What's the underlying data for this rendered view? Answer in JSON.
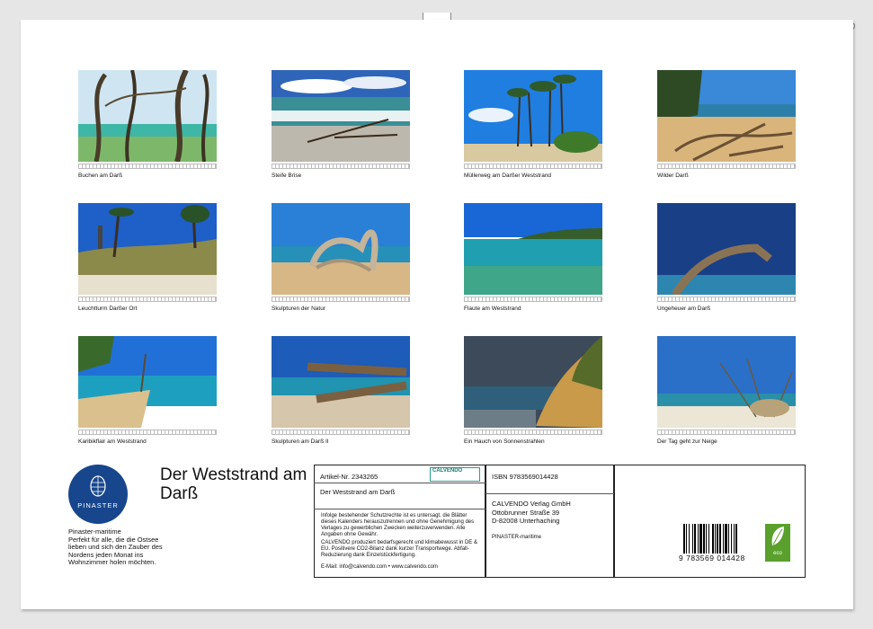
{
  "captions": [
    "Buchen am Darß",
    "Steife Brise",
    "Müllerweg am Darßer Weststrand",
    "Wilder Darß",
    "Leuchtturm Darßer Ort",
    "Skulpturen der Natur",
    "Flaute am Weststrand",
    "Ungeheuer am Darß",
    "Karibikflair am Weststrand",
    "Skulpturen am Darß II",
    "Ein Hauch von Sonnenstrahlen",
    "Der Tag geht zur Neige"
  ],
  "publisher": {
    "logo_text": "PINASTER",
    "name": "Pinaster-maritime",
    "description": "Perfekt für alle, die die Ostsee lieben und sich den Zauber des Nordens jeden Monat ins Wohnzimmer holen möchten."
  },
  "title": "Der Weststrand am Darß",
  "info": {
    "article_no": "Artikel-Nr. 2343265",
    "calvendo_logo": "CALVENDO",
    "title": "Der Weststrand am Darß",
    "copyright_text": "Infolge bestehender Schutzrechte ist es untersagt, die Blätter dieses Kalenders herauszutrennen und ohne Genehmigung des Verlages zu gewerblichen Zwecken weiterzuverwenden. Alle Angaben ohne Gewähr.",
    "climate_text": "CALVENDO produziert bedarfsgerecht und klimabewusst in DE & EU. Positivere CO2-Bilanz dank kurzer Transportwege. Abfall-Reduzierung dank Einzelstückfertigung.",
    "contact": "E-Mail: info@calvendo.com • www.calvendo.com",
    "isbn": "ISBN 9783569014428",
    "address_line1": "CALVENDO Verlag GmbH",
    "address_line2": "Ottobrunner Straße 39",
    "address_line3": "D-82008 Unterhaching",
    "author": "PINASTER-maritime",
    "barcode_digits": "9 783569 014428",
    "eco_label": "eco"
  }
}
